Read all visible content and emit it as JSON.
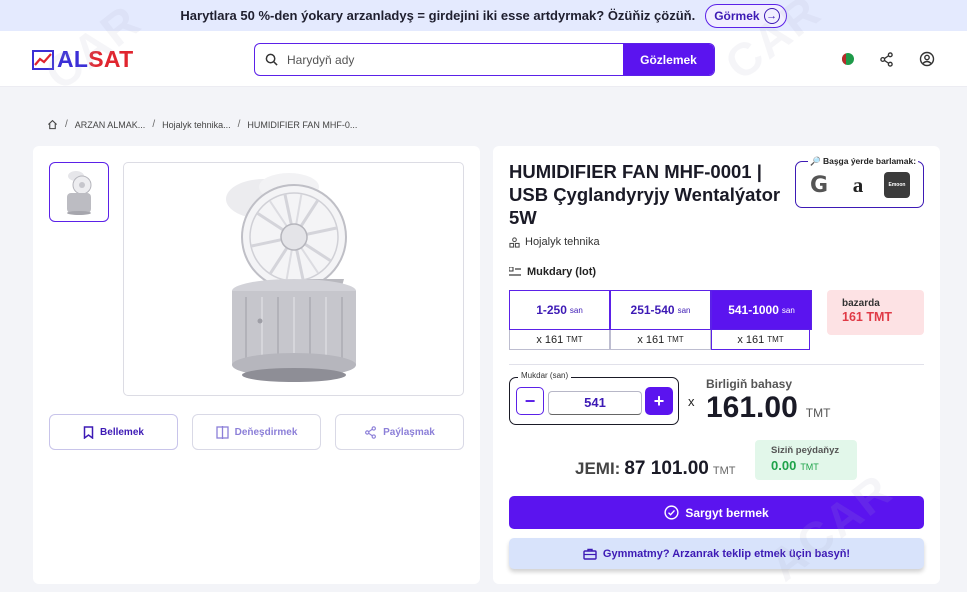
{
  "promo": {
    "text": "Harytlara 50 %-den ýokary arzanladyş = girdejini iki esse artdyrmak? Özüňiz çözüň.",
    "button_label": "Görmek"
  },
  "header": {
    "logo": "ALSAT",
    "search_placeholder": "Harydyň ady",
    "search_button": "Gözlemek"
  },
  "breadcrumb": [
    "ARZAN ALMAK...",
    "Hojalyk tehnika...",
    "HUMIDIFIER FAN MHF-0..."
  ],
  "gallery": {
    "actions": {
      "bookmark": "Bellemek",
      "compare": "Deňeşdirmek",
      "share": "Paýlaşmak"
    }
  },
  "product": {
    "title": "HUMIDIFIER FAN MHF-0001 | USB Çyglandyryjy Wentalýator 5W",
    "category": "Hojalyk tehnika",
    "elsewhere_label": "Başga ýerde barlamak:",
    "stores": [
      "G",
      "a",
      "Emoon"
    ],
    "quantity_label": "Mukdary (lot)",
    "tiers": [
      {
        "range": "1-250",
        "unit": "san",
        "price": "x 161",
        "currency": "TMT"
      },
      {
        "range": "251-540",
        "unit": "san",
        "price": "x 161",
        "currency": "TMT"
      },
      {
        "range": "541-1000",
        "unit": "san",
        "price": "x 161",
        "currency": "TMT"
      }
    ],
    "market": {
      "label": "bazarda",
      "value": "161 TMT"
    },
    "quantity": {
      "label": "Mukdar (san)",
      "value": "541",
      "minus": "−",
      "plus": "+"
    },
    "times": "x",
    "unit_price": {
      "label": "Birligiň bahasy",
      "value": "161.00",
      "currency": "TMT"
    },
    "total": {
      "label": "JEMI:",
      "value": "87 101.00",
      "currency": "TMT"
    },
    "profit": {
      "label": "Siziň peýdaňyz",
      "value": "0.00",
      "currency": "TMT"
    },
    "order_button": "Sargyt bermek",
    "offer_button": "Gymmatmy? Arzanrak teklip etmek üçin basyň!"
  },
  "colors": {
    "accent": "#5b14ef",
    "danger": "#e03a46",
    "success": "#1fa34a"
  }
}
